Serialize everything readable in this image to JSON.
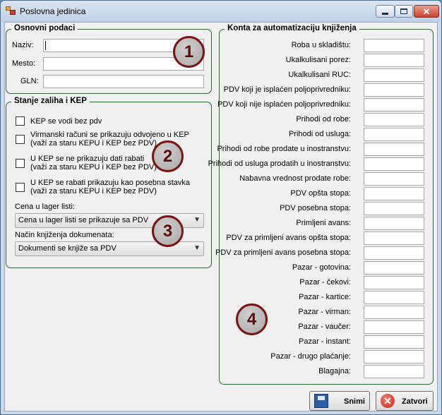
{
  "window": {
    "title": "Poslovna jedinica"
  },
  "basic": {
    "legend": "Osnovni podaci",
    "naziv_label": "Naziv:",
    "naziv_value": "",
    "mesto_label": "Mesto:",
    "mesto_value": "",
    "gln_label": "GLN:",
    "gln_value": ""
  },
  "stock": {
    "legend": "Stanje zaliha i KEP",
    "checkboxes": [
      {
        "lines": [
          "KEP se vodi bez pdv"
        ],
        "checked": false
      },
      {
        "lines": [
          "Virmanski računi se prikazuju odvojeno u KEP",
          "(važi za staru KEPU i KEP bez PDV)"
        ],
        "checked": false
      },
      {
        "lines": [
          "U KEP se ne prikazuju dati rabati",
          "(važi za staru KEPU i KEP bez PDV)"
        ],
        "checked": false
      },
      {
        "lines": [
          "U KEP se rabati prikazuju kao posebna stavka",
          "(važi za staru KEPU i KEP bez PDV)"
        ],
        "checked": false
      }
    ],
    "price_label": "Cena u lager listi:",
    "price_value": "Cena u lager listi se prikazuje sa PDV",
    "booking_label": "Način knjiženja dokumenata:",
    "booking_value": "Dokumenti se knjiže sa PDV"
  },
  "accounts": {
    "legend": "Konta za automatizaciju knjiženja",
    "fields": [
      {
        "label": "Roba u skladištu:",
        "value": ""
      },
      {
        "label": "Ukalkulisani porez:",
        "value": ""
      },
      {
        "label": "Ukalkulisani RUC:",
        "value": ""
      },
      {
        "label": "PDV koji je isplaćen poljoprivredniku:",
        "value": ""
      },
      {
        "label": "PDV koji nije isplaćen poljoprivredniku:",
        "value": ""
      },
      {
        "label": "Prihodi od robe:",
        "value": ""
      },
      {
        "label": "Prihodi od usluga:",
        "value": ""
      },
      {
        "label": "Prihodi od robe prodate u inostranstvu:",
        "value": ""
      },
      {
        "label": "Prihodi od usluga prodatih u inostranstvu:",
        "value": ""
      },
      {
        "label": "Nabavna vrednost prodate robe:",
        "value": ""
      },
      {
        "label": "PDV opšta stopa:",
        "value": ""
      },
      {
        "label": "PDV posebna stopa:",
        "value": ""
      },
      {
        "label": "Primljeni avans:",
        "value": ""
      },
      {
        "label": "PDV za primljeni avans opšta stopa:",
        "value": ""
      },
      {
        "label": "PDV za primljeni avans posebna stopa:",
        "value": ""
      },
      {
        "label": "Pazar - gotovina:",
        "value": ""
      },
      {
        "label": "Pazar - čekovi:",
        "value": ""
      },
      {
        "label": "Pazar - kartice:",
        "value": ""
      },
      {
        "label": "Pazar - virman:",
        "value": ""
      },
      {
        "label": "Pazar - vaučer:",
        "value": ""
      },
      {
        "label": "Pazar - instant:",
        "value": ""
      },
      {
        "label": "Pazar - drugo plaćanje:",
        "value": ""
      },
      {
        "label": "Blagajna:",
        "value": ""
      }
    ]
  },
  "callouts": [
    "1",
    "2",
    "3",
    "4"
  ],
  "buttons": {
    "save": "Snimi",
    "close": "Zatvori"
  },
  "icons": {
    "app": "app-icon",
    "minimize": "minimize-icon",
    "maximize": "maximize-icon",
    "close": "close-icon",
    "save": "floppy-disk-icon",
    "cancel": "red-x-circle-icon",
    "dropdown": "chevron-down-icon"
  }
}
